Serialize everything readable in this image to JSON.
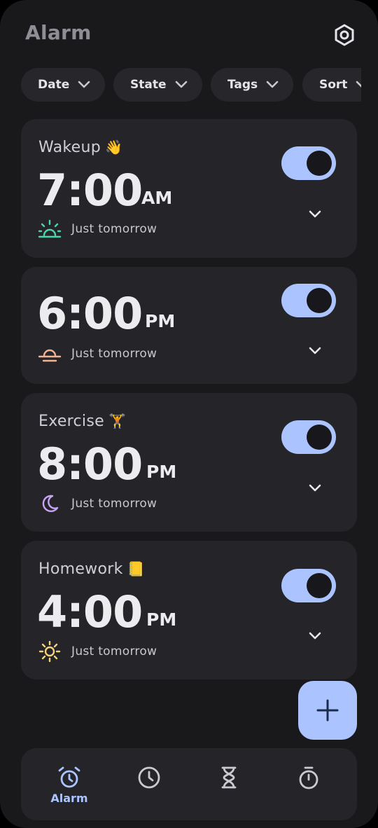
{
  "header": {
    "title": "Alarm",
    "settings_icon": "settings-icon"
  },
  "filters": [
    {
      "label": "Date"
    },
    {
      "label": "State"
    },
    {
      "label": "Tags"
    },
    {
      "label": "Sort"
    }
  ],
  "alarms": [
    {
      "label": "Wakeup",
      "emoji": "👋",
      "time": "7:00",
      "ampm": "AM",
      "schedule": "Just tomorrow",
      "icon": "sunrise-icon",
      "icon_color": "#4ad6a6",
      "enabled": true
    },
    {
      "label": "",
      "emoji": "",
      "time": "6:00",
      "ampm": "PM",
      "schedule": "Just tomorrow",
      "icon": "sunset-icon",
      "icon_color": "#f4b193",
      "enabled": true
    },
    {
      "label": "Exercise",
      "emoji": "🏋",
      "time": "8:00",
      "ampm": "PM",
      "schedule": "Just tomorrow",
      "icon": "moon-icon",
      "icon_color": "#c7a6f5",
      "enabled": true
    },
    {
      "label": "Homework",
      "emoji": "📒",
      "time": "4:00",
      "ampm": "PM",
      "schedule": "Just tomorrow",
      "icon": "sun-icon",
      "icon_color": "#f3d27a",
      "enabled": true
    }
  ],
  "fab": {
    "icon": "plus-icon"
  },
  "nav": [
    {
      "label": "Alarm",
      "icon": "alarm-clock-icon",
      "active": true
    },
    {
      "label": "",
      "icon": "clock-icon",
      "active": false
    },
    {
      "label": "",
      "icon": "hourglass-icon",
      "active": false
    },
    {
      "label": "",
      "icon": "stopwatch-icon",
      "active": false
    }
  ],
  "colors": {
    "accent": "#abc4ff",
    "background": "#19191c",
    "card": "#252529"
  }
}
